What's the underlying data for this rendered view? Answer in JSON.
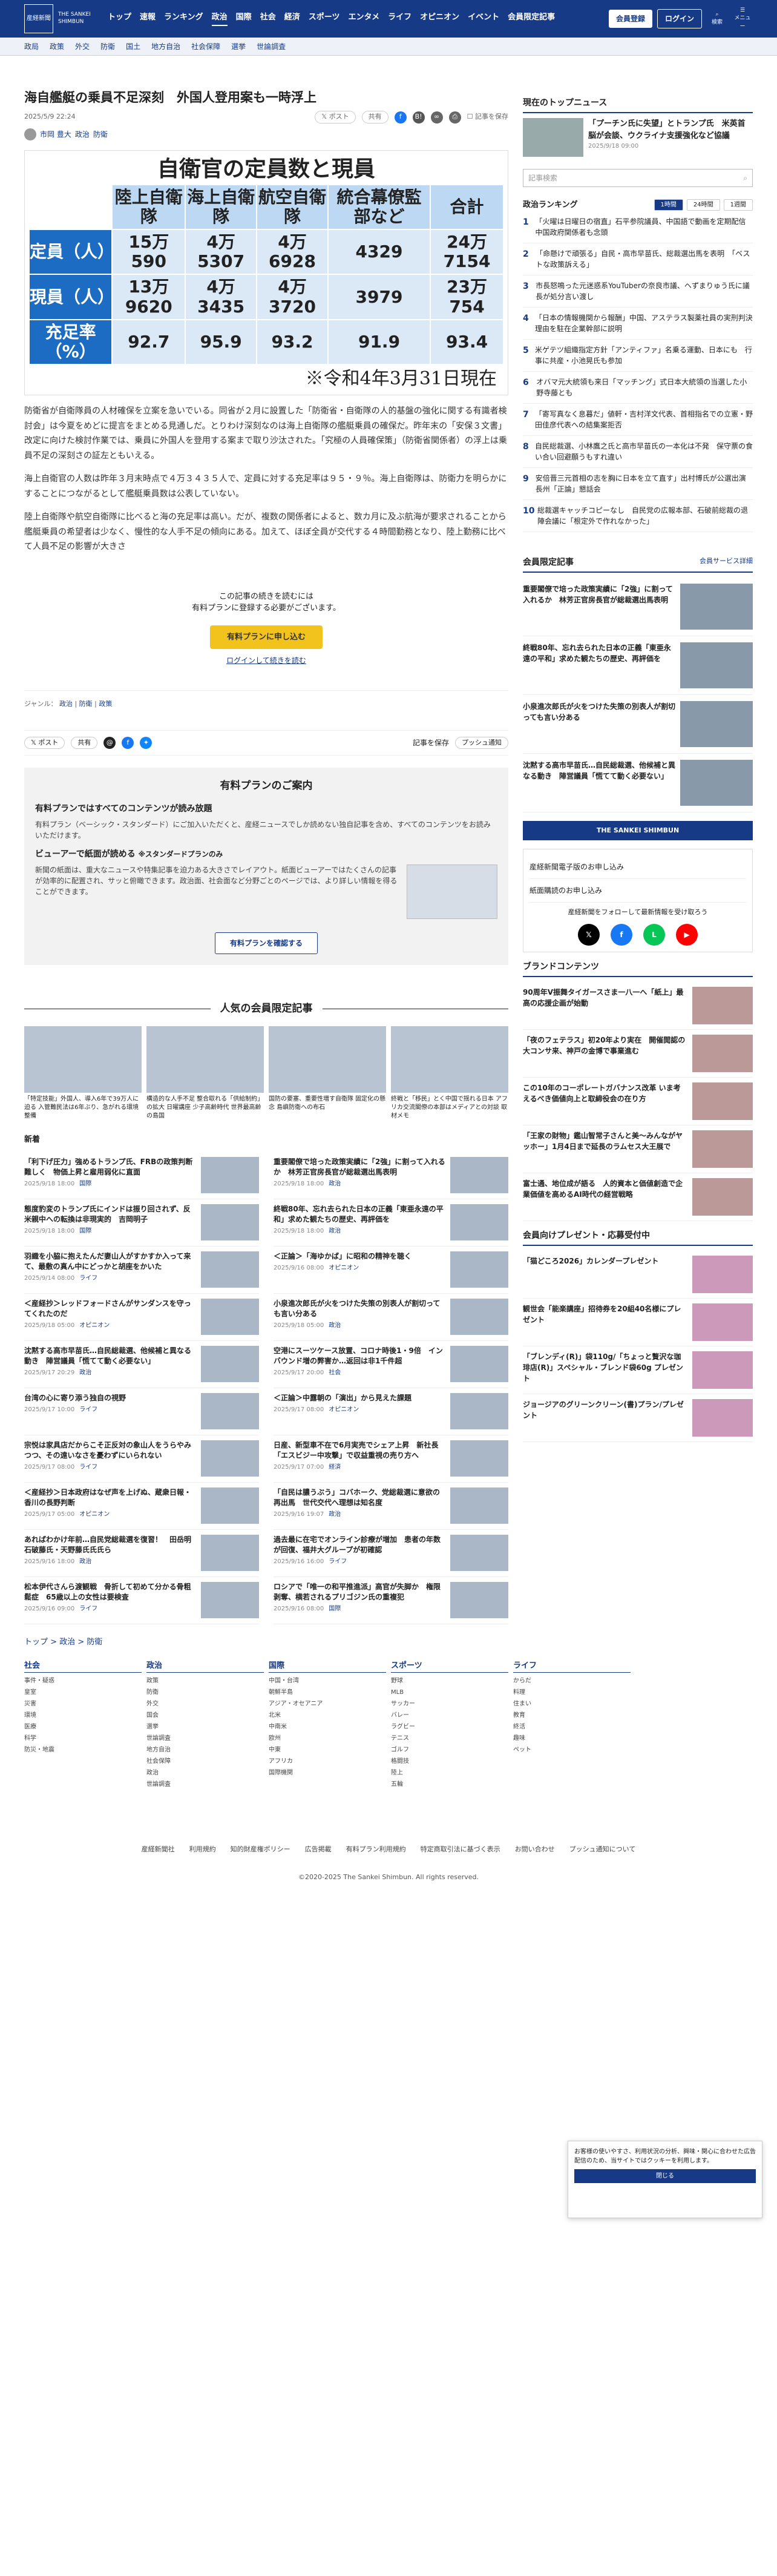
{
  "header": {
    "logo_jp": "産経新聞",
    "logo_en": "THE SANKEI SHIMBUN",
    "nav": [
      "トップ",
      "速報",
      "ランキング",
      "政治",
      "国際",
      "社会",
      "経済",
      "スポーツ",
      "エンタメ",
      "ライフ",
      "オピニオン",
      "イベント",
      "会員限定記事"
    ],
    "active": "政治",
    "member_btn": "会員登録",
    "login_btn": "ログイン",
    "search_label": "検索",
    "menu_label": "メニュー"
  },
  "subnav": [
    "政局",
    "政策",
    "外交",
    "防衛",
    "国土",
    "地方自治",
    "社会保障",
    "選挙",
    "世論調査"
  ],
  "article": {
    "title": "海自艦艇の乗員不足深刻　外国人登用案も一時浮上",
    "date": "2025/5/9 22:24",
    "post_label": "ポスト",
    "share_label": "共有",
    "save_label": "記事を保存",
    "author": "市岡 豊大",
    "category": "政治",
    "subcategory": "防衛",
    "figure": {
      "title": "自衛官の定員数と現員",
      "headers": [
        "陸上自衛隊",
        "海上自衛隊",
        "航空自衛隊",
        "統合幕僚監部など",
        "合計"
      ],
      "rows": [
        {
          "label": "定員（人）",
          "values": [
            "15万590",
            "4万5307",
            "4万6928",
            "4329",
            "24万7154"
          ]
        },
        {
          "label": "現員（人）",
          "values": [
            "13万9620",
            "4万3435",
            "4万3720",
            "3979",
            "23万754"
          ]
        },
        {
          "label": "充足率（%）",
          "values": [
            "92.7",
            "95.9",
            "93.2",
            "91.9",
            "93.4"
          ]
        }
      ],
      "note": "※令和4年3月31日現在"
    },
    "paras": [
      "防衛省が自衛隊員の人材確保を立案を急いでいる。同省が２月に設置した「防衛省・自衛隊の人的基盤の強化に関する有識者検討会」は今夏をめどに提言をまとめる見通しだ。とりわけ深刻なのは海上自衛隊の艦艇乗員の確保だ。昨年末の「安保３文書」改定に向けた検討作業では、乗員に外国人を登用する案まで取り沙汰された。「究極の人員確保策」（防衛省関係者）の浮上は乗員不足の深刻さの証左ともいえる。",
      "海上自衛官の人数は昨年３月末時点で４万３４３５人で、定員に対する充足率は９５・９％。海上自衛隊は、防衛力を明らかにすることにつながるとして艦艇乗員数は公表していない。",
      "陸上自衛隊や航空自衛隊に比べると海の充足率は高い。だが、複数の関係者によると、数カ月に及ぶ航海が要求されることから艦艇乗員の希望者は少なく、慢性的な人手不足の傾向にある。加えて、ほぼ全員が交代する４時間勤務となり、陸上勤務に比べて人員不足の影響が大きさ"
    ],
    "paywall": {
      "line1": "この記事の続きを読むには",
      "line2": "有料プランに登録する必要がございます。",
      "btn": "有料プランに申し込む",
      "login": "ログインして続きを読む"
    },
    "genre_label": "ジャンル：",
    "genres": [
      "政治",
      "防衛",
      "政策"
    ],
    "post_label2": "ポスト",
    "share2": "共有",
    "save2": "記事を保存",
    "push": "プッシュ通知"
  },
  "plan": {
    "title": "有料プランのご案内",
    "h1": "有料プランではすべてのコンテンツが読み放題",
    "p1": "有料プラン（ベーシック・スタンダード）にご加入いただくと、産経ニュースでしか読めない独自記事を含め、すべてのコンテンツをお読みいただけます。",
    "h2": "ビューアーで紙面が読める",
    "h2tag": "※スタンダードプランのみ",
    "p2": "新聞の紙面は、重大なニュースや特集記事を迫力ある大きさでレイアウト。紙面ビューアーではたくさんの記事が効率的に配置され、サッと俯瞰できます。政治面、社会面など分野ごとのページでは、より詳しい情報を得ることができます。",
    "btn": "有料プランを確認する"
  },
  "popular": {
    "title": "人気の会員限定記事",
    "items": [
      "「特定技能」外国人、導入6年で39万人に迫る 入管難民法は6年ぶり、急がれる環境整備",
      "構造的な人手不足 整合取れる「供給制約」の拡大 日曜講座 少子高齢時代 世界最高齢の島国",
      "国防の要塞、重要性増す自衛隊 固定化の懸念 島嶼防衛への布石",
      "終戦と「移民」とく中国で揺れる日本 アフリカ交流閣僚の本部はメディアとの対談 取材メモ"
    ]
  },
  "news_title": "新着",
  "news": [
    {
      "t": "「利下げ圧力」強めるトランプ氏、FRBの政策判断難しく　物価上昇と雇用弱化に直面",
      "d": "2025/9/18 18:00",
      "tag": "国際"
    },
    {
      "t": "重要閣僚で培った政策実績に「2強」に割って入れるか　林芳正官房長官が総裁選出馬表明",
      "d": "2025/9/18 18:00",
      "tag": "政治"
    },
    {
      "t": "態度豹変のトランプ氏にインドは振り回されず、反米親中への転換は非現実的　吉岡明子",
      "d": "2025/9/18 18:00",
      "tag": "国際"
    },
    {
      "t": "終戦80年、忘れ去られた日本の正義「東亜永遠の平和」求めた観たちの歴史、再評価を",
      "d": "2025/9/18 18:00",
      "tag": "政治"
    },
    {
      "t": "羽織を小脇に抱えたんだ妻山人がすかすか入って来て、最敷の真ん中にどっかと胡座をかいた",
      "d": "2025/9/14 08:00",
      "tag": "ライフ"
    },
    {
      "t": "＜正論＞「海ゆかば」に昭和の精神を聴く",
      "d": "2025/9/16 08:00",
      "tag": "オピニオン"
    },
    {
      "t": "＜産経抄＞レッドフォードさんがサンダンスを守ってくれたのだ",
      "d": "2025/9/18 05:00",
      "tag": "オピニオン"
    },
    {
      "t": "小泉進次郎氏が火をつけた失策の別表人が割切っても言い分ある",
      "d": "2025/9/18 05:00",
      "tag": "政治"
    },
    {
      "t": "沈黙する高市早苗氏…自民総裁選、他候補と異なる動き　陣営議員「慌てて動く必要ない」",
      "d": "2025/9/17 20:29",
      "tag": "政治"
    },
    {
      "t": "空港にスーツケース放置、コロナ時後1・9倍　インバウンド増の弊害か…返回は非1千件超",
      "d": "2025/9/17 20:00",
      "tag": "社会"
    },
    {
      "t": "台湾の心に寄り添う独自の視野",
      "d": "2025/9/17 10:00",
      "tag": "ライフ"
    },
    {
      "t": "＜正論＞中露朝の「演出」から見えた課題",
      "d": "2025/9/17 08:00",
      "tag": "オピニオン"
    },
    {
      "t": "宗悦は家具店だからこそ正反対の象山人をうらやみつつ、その遠いなさを憂わずにいられない",
      "d": "2025/9/17 08:00",
      "tag": "ライフ"
    },
    {
      "t": "日産、新型車不在で6月実売でシェア上昇　新社長「エスビジー中攻撃」で収益重視の売り方へ",
      "d": "2025/9/17 07:00",
      "tag": "経済"
    },
    {
      "t": "＜産経抄＞日本政府はなぜ声を上げぬ、蔵衆日報・香川の長野判断",
      "d": "2025/9/17 05:00",
      "tag": "オピニオン"
    },
    {
      "t": "「自民は膿うぶう」コバホーク、党総裁選に意欲の再出馬　世代交代へ理想は知名度",
      "d": "2025/9/16 19:07",
      "tag": "政治"
    },
    {
      "t": "あればわかけ年前…自民党総裁選を復習！　田岳明石破藤氏・天野藤氏氏氏ら",
      "d": "2025/9/16 18:00",
      "tag": "政治"
    },
    {
      "t": "過去最に在宅でオンライン診療が増加　患者の年数が回復、福井大グループが初確認",
      "d": "2025/9/16 16:00",
      "tag": "ライフ"
    },
    {
      "t": "松本伊代さんら渡観戦　骨折して初めて分かる骨粗鬆症　65歳以上の女性は要検査",
      "d": "2025/9/16 09:00",
      "tag": "ライフ"
    },
    {
      "t": "ロシアで「唯一の和平推進派」高官が失脚か　権限剥奪、横若されるプリゴジン氏の重複犯",
      "d": "2025/9/16 08:00",
      "tag": "国際"
    }
  ],
  "side": {
    "top_news_title": "現在のトップニュース",
    "top_news": {
      "t": "「プーチン氏に失望」とトランプ氏　米英首脳が会談、ウクライナ支援強化など協議",
      "d": "2025/9/18 09:00"
    },
    "search_ph": "記事検索",
    "ranking_title": "政治ランキング",
    "ranking_tabs": [
      "1時間",
      "24時間",
      "1週間"
    ],
    "ranking": [
      "「火曜は日曜日の宿直」石平参院議員、中国語で動画を定期配信　中国政府関係者も念頭",
      "「命懸けで頑張る」自民・高市早苗氏、総裁選出馬を表明　「ベストな政策訴える」",
      "市長怒鳴った元迷惑系YouTuberの奈良市議、ヘずまりゅう氏に議長が処分言い渡し",
      "「日本の情報機関から報酬」中国、アステラス製薬社員の実刑判決理由を駐在企業幹部に説明",
      "米ゲテツ組織指定方針「アンティファ」名乗る運動、日本にも　行事に共産・小池晃氏も参加",
      "オバマ元大統領も来日「マッチング」式日本大統領の当選した小野寺藤とも",
      "「寄写真なく息暮だ」値軒・吉村洋文代表、首相指名での立憲・野田佳彦代表への結集案拒否",
      "自民総裁選、小林鷹之氏と高市早苗氏の一本化は不発　保守票の食い合い回避願うもすれ違い",
      "安倍晋三元首相の志を胸に日本を立て直す」出村博氏が公選出演　長州「正論」懇話会",
      "総裁選キャッチコピーなし　自民党の広報本部、石破前総裁の退陣会議に「根定外で作れなかった」"
    ],
    "member_title": "会員限定記事",
    "member_link": "会員サービス詳細",
    "members": [
      "重要閣僚で培った政策実績に「2強」に割って入れるか　林芳正官房長官が総裁選出馬表明",
      "終戦80年、忘れ去られた日本の正義「東亜永遠の平和」求めた観たちの歴史、再評価を",
      "小泉進次郎氏が火をつけた失策の別表人が割切っても言い分ある",
      "沈黙する高市早苗氏…自民総裁選、他候補と異なる動き　陣営議員「慌てて動く必要ない」"
    ],
    "banner": "THE SANKEI SHIMBUN",
    "box_rows": [
      "産経新聞電子版のお申し込み",
      "紙面購読のお申し込み"
    ],
    "follow": "産経新聞をフォローして最新情報を受け取ろう",
    "brand_title": "ブランドコンテンツ",
    "brands": [
      "90周年V振舞タイガースさま一八一へ「紙上」最高の応援企画が始動",
      "「夜のフェテラス」初20年より実在　開催閲認の大コンサ来、神戸の金博で事業進む",
      "この10年のコーポレートガバナンス改革 いま考えるべき価値向上と取締役会の在り方",
      "「王家の財物」鑑山智常子さんと美〜みんながヤッホー」1月4日まで延長のラムセス大王展で",
      "富士通、地位成が語る　人的資本と価値創造で企業価値を高めるAI時代の経営戦略"
    ],
    "gift_title": "会員向けプレゼント・応募受付中",
    "gifts": [
      "「猫どころ2026」カレンダープレゼント",
      "観世会「能楽講座」招待券を20組40名様にプレゼント",
      "「ブレンディ(R)」袋110g/「ちょっと贅沢な珈琲店(R)」スペシャル・ブレンド袋60g プレゼント",
      "ジョージアのグリーンクリーン(書)プラン/プレゼント"
    ]
  },
  "breadcrumb": [
    "トップ",
    "政治",
    "防衛"
  ],
  "footer": [
    {
      "h": "社会",
      "i": [
        "事件・疑惑",
        "皇室",
        "災害",
        "環境",
        "医療",
        "科学",
        "防災・地震"
      ]
    },
    {
      "h": "政治",
      "i": [
        "政策",
        "防衛",
        "外交",
        "国会",
        "選挙",
        "世論調査",
        "地方自治",
        "社会保障",
        "政治",
        "世論調査"
      ]
    },
    {
      "h": "国際",
      "i": [
        "中国・台湾",
        "朝鮮半島",
        "アジア・オセアニア",
        "北米",
        "中南米",
        "欧州",
        "中東",
        "アフリカ",
        "国際機関"
      ]
    },
    {
      "h": "スポーツ",
      "i": [
        "野球",
        "MLB",
        "サッカー",
        "バレー",
        "ラグビー",
        "テニス",
        "ゴルフ",
        "格闘技",
        "陸上",
        "五輪"
      ]
    },
    {
      "h": "ライフ",
      "i": [
        "からだ",
        "料理",
        "住まい",
        "教育",
        "終活",
        "趣味",
        "ペット"
      ]
    },
    {
      "h": "",
      "i": []
    }
  ],
  "footer_links": [
    "産経新聞社",
    "利用規約",
    "知的財産権ポリシー",
    "広告掲載",
    "有料プラン利用規約",
    "特定商取引法に基づく表示",
    "お問い合わせ",
    "プッシュ通知について"
  ],
  "copyright": "©2020-2025 The Sankei Shimbun. All rights reserved.",
  "cookie": {
    "text": "お客様の使いやすさ、利用状況の分析、興味・関心に合わせた広告配信のため、当サイトではクッキーを利用します。",
    "btn": "閉じる"
  }
}
